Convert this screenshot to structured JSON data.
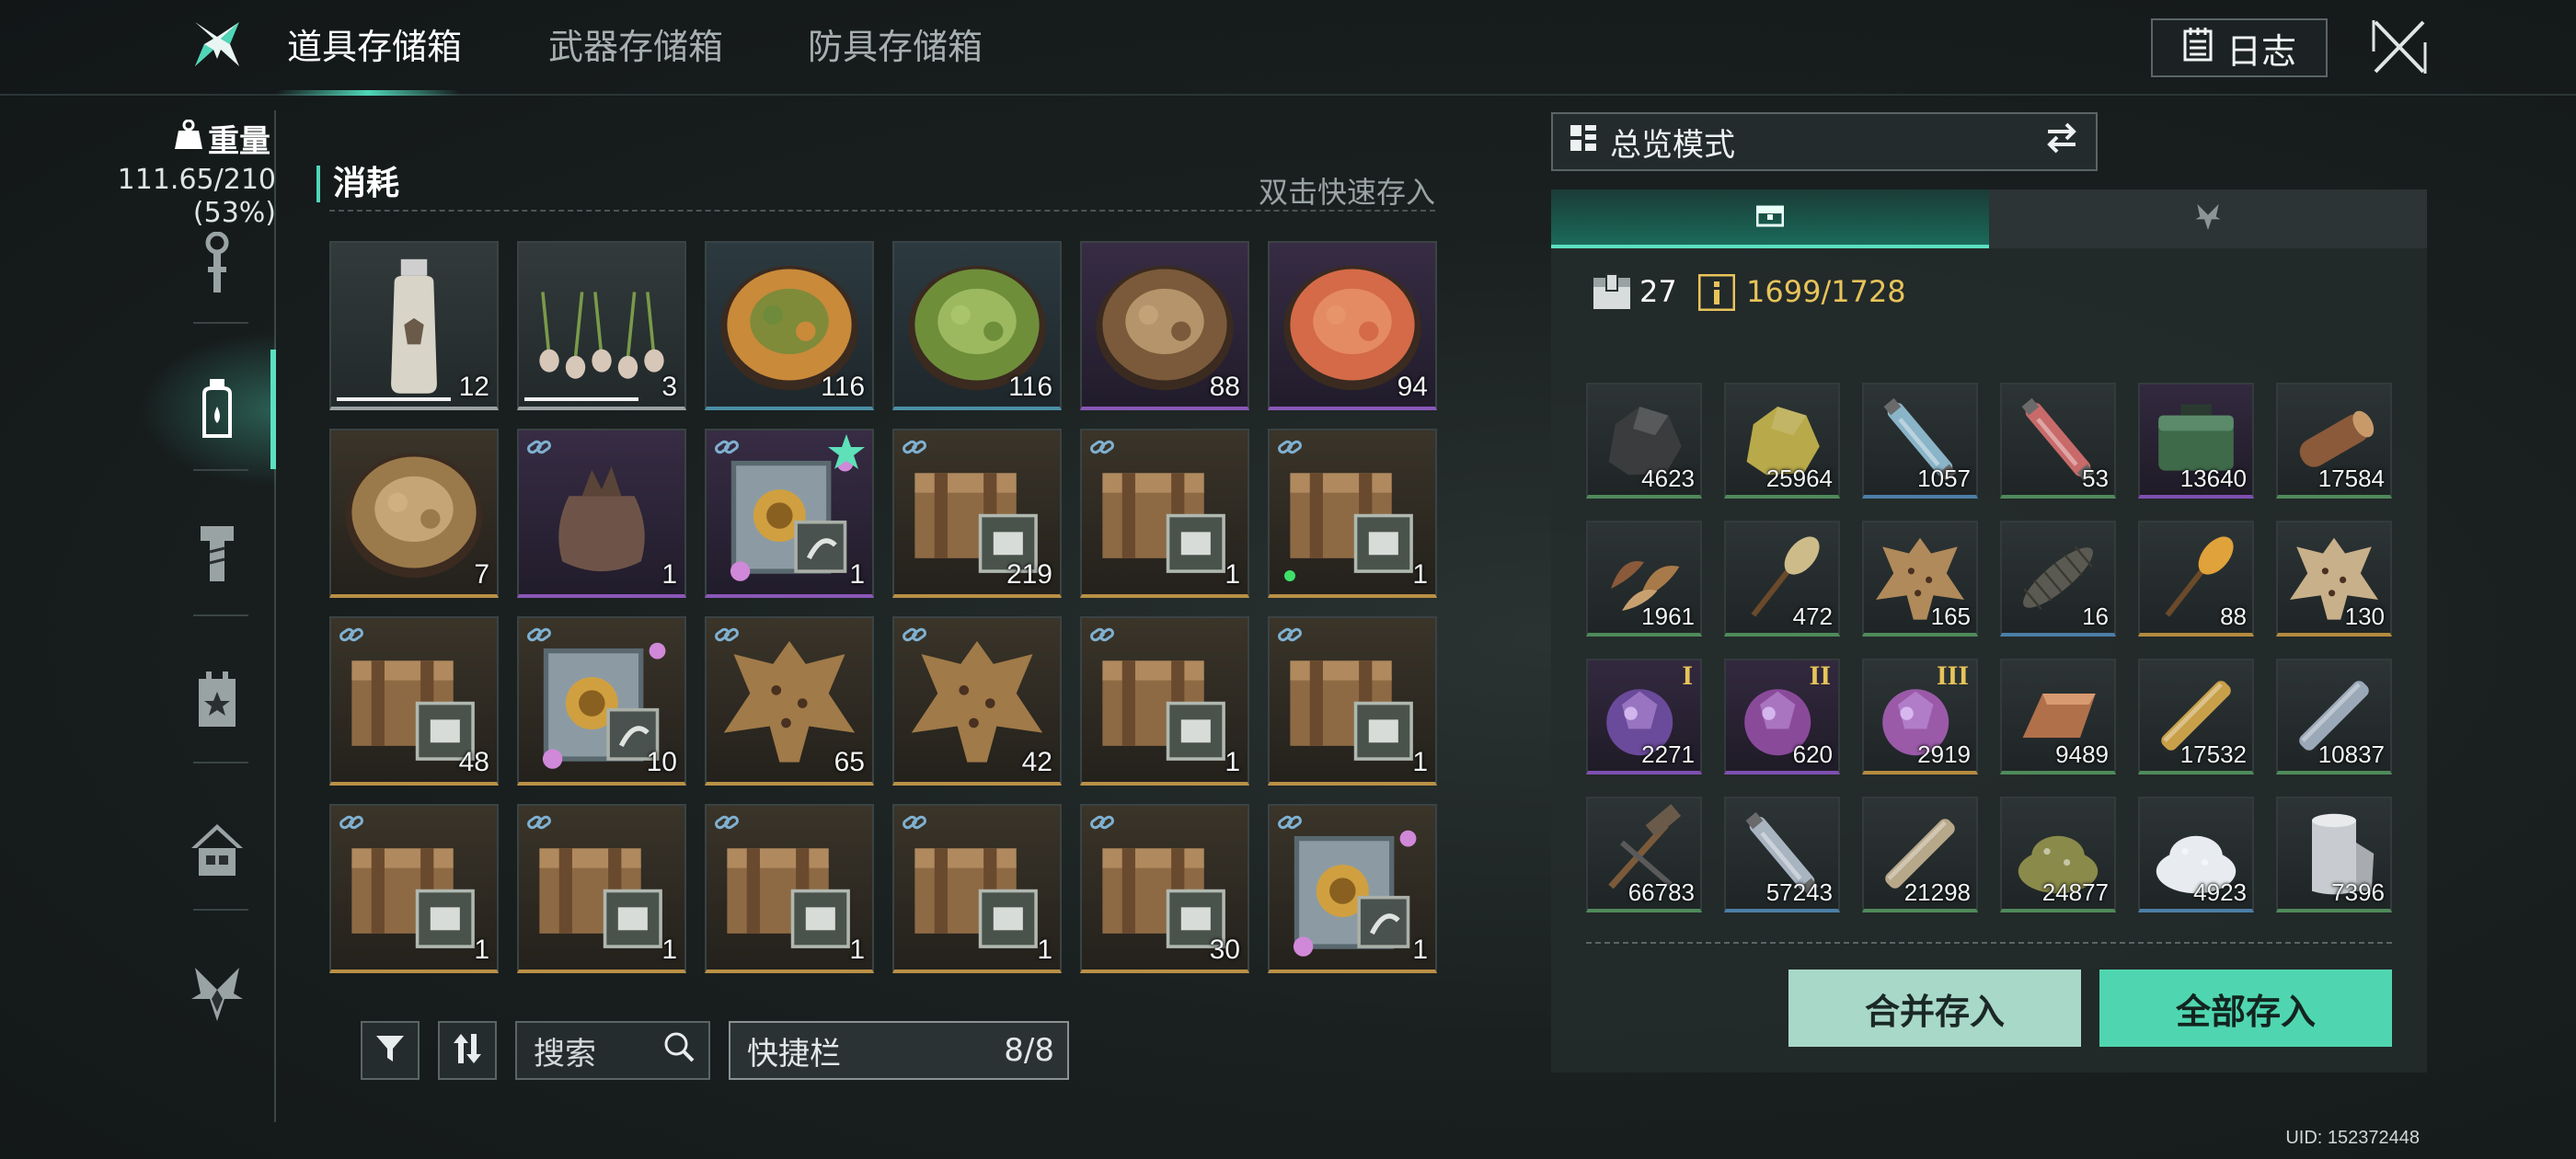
{
  "tabs": [
    {
      "label": "道具存储箱",
      "active": true
    },
    {
      "label": "武器存储箱",
      "active": false
    },
    {
      "label": "防具存储箱",
      "active": false
    }
  ],
  "log_button": {
    "label": "日志",
    "icon": "notepad-icon"
  },
  "close_icon": "close-icon",
  "weight": {
    "label": "重量",
    "value": "111.65/210",
    "percent": "(53%)"
  },
  "sidebar_icons": [
    "wrench-icon",
    "bottle-icon",
    "bolt-icon",
    "calendar-star-icon",
    "home-icon",
    "emblem-icon"
  ],
  "section": {
    "title": "消耗",
    "hint": "双击快速存入"
  },
  "items": [
    {
      "name": "milk-bottle",
      "qty": "12",
      "rarity": "white",
      "bar": true,
      "art": "bottle",
      "color": "#d8d4c8"
    },
    {
      "name": "garlic-sprouts",
      "qty": "3",
      "rarity": "white",
      "bar": true,
      "art": "garlic",
      "color": "#d7c7b9"
    },
    {
      "name": "noodle-plate",
      "qty": "116",
      "rarity": "blue",
      "art": "plate",
      "color": "#c98a3a",
      "topping": "#6d8b3a"
    },
    {
      "name": "lettuce-plate",
      "qty": "116",
      "rarity": "blue",
      "art": "plate",
      "color": "#6f8e3a",
      "topping": "#a9c46a"
    },
    {
      "name": "mushroom-plate",
      "qty": "88",
      "rarity": "purple",
      "art": "plate",
      "color": "#7a5a3a",
      "topping": "#c4a278"
    },
    {
      "name": "shrimp-plate",
      "qty": "94",
      "rarity": "purple",
      "art": "plate",
      "color": "#d46a48",
      "topping": "#e7946a"
    },
    {
      "name": "abalone-plate",
      "qty": "7",
      "rarity": "gold",
      "art": "plate",
      "color": "#9a7a4a",
      "topping": "#d0b080"
    },
    {
      "name": "cloth-sack",
      "qty": "1",
      "rarity": "purple",
      "lock": true,
      "art": "sack",
      "color": "#6e5448"
    },
    {
      "name": "steel-safe",
      "qty": "1",
      "rarity": "purple",
      "lock": true,
      "star": true,
      "art": "safe",
      "color": "#8c9ba3"
    },
    {
      "name": "weapon-crate",
      "qty": "219",
      "rarity": "gold",
      "lock": true,
      "art": "crate",
      "color": "#8e6a44"
    },
    {
      "name": "armor-crate",
      "qty": "1",
      "rarity": "gold",
      "lock": true,
      "art": "crate",
      "color": "#8e6a44"
    },
    {
      "name": "helmet-crate",
      "qty": "1",
      "rarity": "gold",
      "lock": true,
      "dot": true,
      "art": "crate",
      "color": "#8e6a44"
    },
    {
      "name": "pistol-crate",
      "qty": "48",
      "rarity": "gold",
      "lock": true,
      "art": "crate",
      "color": "#8e6a44"
    },
    {
      "name": "gold-safe",
      "qty": "10",
      "rarity": "gold",
      "lock": true,
      "art": "safe",
      "color": "#8c9ba3"
    },
    {
      "name": "leopard-hide",
      "qty": "65",
      "rarity": "gold",
      "lock": true,
      "art": "hide",
      "color": "#a07a48"
    },
    {
      "name": "leopard-hide",
      "qty": "42",
      "rarity": "gold",
      "lock": true,
      "art": "hide",
      "color": "#a07a48"
    },
    {
      "name": "vest-crate",
      "qty": "1",
      "rarity": "gold",
      "lock": true,
      "art": "crate",
      "color": "#8e6a44"
    },
    {
      "name": "boots-crate",
      "qty": "1",
      "rarity": "gold",
      "lock": true,
      "art": "crate",
      "color": "#8e6a44"
    },
    {
      "name": "helmet-crate",
      "qty": "1",
      "rarity": "gold",
      "lock": true,
      "art": "crate",
      "color": "#8e6a44"
    },
    {
      "name": "shirt-crate",
      "qty": "1",
      "rarity": "gold",
      "lock": true,
      "art": "crate",
      "color": "#8e6a44"
    },
    {
      "name": "pants-crate",
      "qty": "1",
      "rarity": "gold",
      "lock": true,
      "art": "crate",
      "color": "#8e6a44"
    },
    {
      "name": "pistol-crate",
      "qty": "1",
      "rarity": "gold",
      "lock": true,
      "art": "crate",
      "color": "#8e6a44"
    },
    {
      "name": "pistol-crate",
      "qty": "30",
      "rarity": "gold",
      "lock": true,
      "art": "crate",
      "color": "#8e6a44"
    },
    {
      "name": "steel-safe",
      "qty": "1",
      "rarity": "gold",
      "lock": true,
      "art": "safe",
      "color": "#8c9ba3"
    }
  ],
  "toolbar": {
    "filter_icon": "filter-icon",
    "sort_icon": "sort-icon",
    "search_label": "搜索",
    "search_icon": "search-icon",
    "quickbar_label": "快捷栏",
    "quickbar_count": "8/8"
  },
  "storage": {
    "mode_label": "总览模式",
    "mode_icon": "grid-icon",
    "swap_icon": "swap-icon",
    "tabs": [
      {
        "icon": "chest-icon",
        "active": true
      },
      {
        "icon": "emblem-icon",
        "active": false
      }
    ],
    "slots": "27",
    "usage": "1699/1728",
    "items": [
      {
        "name": "coal-ore",
        "qty": "4623",
        "rarity": "green",
        "art": "rock",
        "color": "#3a3c3e"
      },
      {
        "name": "sulfur-ore",
        "qty": "25964",
        "rarity": "green",
        "art": "rock",
        "color": "#b8a94a"
      },
      {
        "name": "blue-vial",
        "qty": "1057",
        "rarity": "blue",
        "art": "vial",
        "color": "#8ab4c8"
      },
      {
        "name": "red-vial",
        "qty": "53",
        "rarity": "green",
        "art": "vial",
        "color": "#c86a6a"
      },
      {
        "name": "green-case",
        "qty": "13640",
        "rarity": "purple",
        "art": "case",
        "color": "#3e6a4a"
      },
      {
        "name": "wood-log",
        "qty": "17584",
        "rarity": "green",
        "art": "log",
        "color": "#8a5a3a"
      },
      {
        "name": "leaf-scraps",
        "qty": "1961",
        "rarity": "green",
        "art": "leaf",
        "color": "#8a5a3a"
      },
      {
        "name": "feather-torch",
        "qty": "472",
        "rarity": "green",
        "art": "torch",
        "color": "#cdbb8a"
      },
      {
        "name": "spotted-hide",
        "qty": "165",
        "rarity": "green",
        "art": "hide",
        "color": "#b08a5a"
      },
      {
        "name": "croc-hide",
        "qty": "16",
        "rarity": "blue",
        "art": "croc",
        "color": "#5a5a52"
      },
      {
        "name": "golden-torch",
        "qty": "88",
        "rarity": "gold",
        "art": "torch",
        "color": "#e0a23a"
      },
      {
        "name": "pale-hide",
        "qty": "130",
        "rarity": "gold",
        "art": "hide",
        "color": "#c8b08a"
      },
      {
        "name": "crystal-tier-1",
        "qty": "2271",
        "rarity": "purple",
        "roman": "I",
        "art": "crystal",
        "color": "#6a4a9a"
      },
      {
        "name": "crystal-tier-2",
        "qty": "620",
        "rarity": "purple",
        "roman": "II",
        "art": "crystal",
        "color": "#8a4a9a"
      },
      {
        "name": "crystal-tier-3",
        "qty": "2919",
        "rarity": "gold",
        "roman": "III",
        "art": "crystal",
        "color": "#9a5aa8"
      },
      {
        "name": "copper-ingot",
        "qty": "9489",
        "rarity": "green",
        "art": "ingot",
        "color": "#b0704a"
      },
      {
        "name": "brass-rod",
        "qty": "17532",
        "rarity": "green",
        "art": "rod",
        "color": "#c8a04a"
      },
      {
        "name": "steel-bar",
        "qty": "10837",
        "rarity": "green",
        "art": "rod",
        "color": "#9aa8b8"
      },
      {
        "name": "scrap-tools",
        "qty": "66783",
        "rarity": "green",
        "art": "tools",
        "color": "#6a5a4a"
      },
      {
        "name": "gas-canister",
        "qty": "57243",
        "rarity": "blue",
        "art": "vial",
        "color": "#a8b4c0"
      },
      {
        "name": "cloth-roll",
        "qty": "21298",
        "rarity": "green",
        "art": "rod",
        "color": "#b8a88a"
      },
      {
        "name": "seed-pile",
        "qty": "24877",
        "rarity": "green",
        "art": "pile",
        "color": "#8a8a4a"
      },
      {
        "name": "salt-pile",
        "qty": "4923",
        "rarity": "blue",
        "art": "pile",
        "color": "#e8ecf0"
      },
      {
        "name": "foil-roll",
        "qty": "7396",
        "rarity": "green",
        "art": "roll",
        "color": "#c8ccd0"
      }
    ],
    "merge_label": "合并存入",
    "deposit_all_label": "全部存入"
  },
  "uid": "UID: 152372448"
}
